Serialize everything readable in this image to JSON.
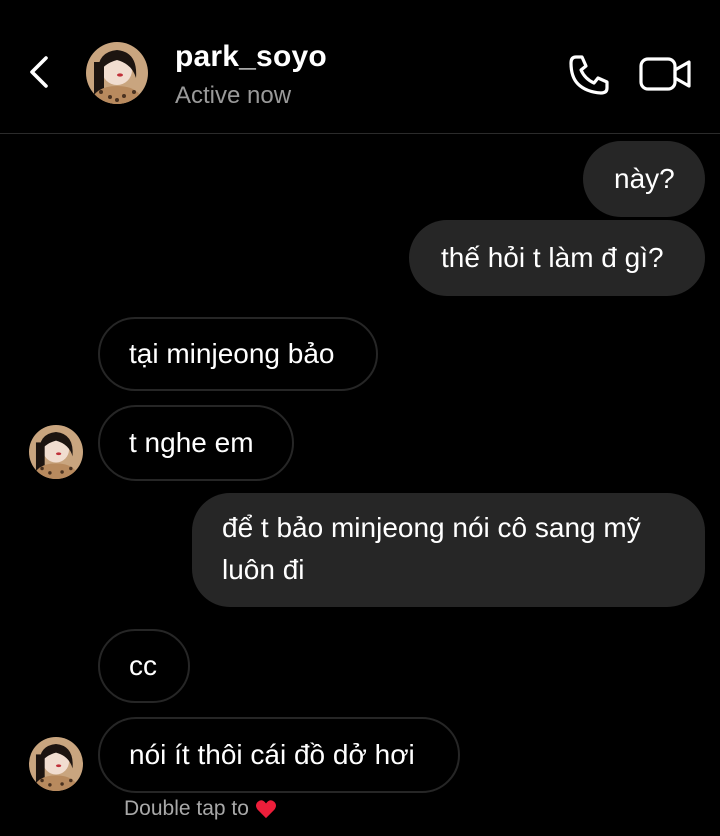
{
  "header": {
    "username": "park_soyo",
    "status": "Active now",
    "icons": {
      "back": "chevron-left-icon",
      "call": "phone-icon",
      "video": "video-camera-icon",
      "avatar": "profile-avatar"
    }
  },
  "messages": [
    {
      "direction": "outgoing",
      "text": "này?"
    },
    {
      "direction": "outgoing",
      "text": "thế hỏi t làm đ gì?"
    },
    {
      "direction": "incoming",
      "text": "tại minjeong bảo"
    },
    {
      "direction": "incoming",
      "text": "t nghe em"
    },
    {
      "direction": "outgoing",
      "text": "để t bảo minjeong nói cô sang mỹ luôn đi"
    },
    {
      "direction": "incoming",
      "text": "cc"
    },
    {
      "direction": "incoming",
      "text": "nói ít thôi cái đồ dở hơi"
    }
  ],
  "hint": {
    "text": "Double tap to",
    "icon": "heart-icon",
    "icon_color": "#ed1e3a"
  },
  "colors": {
    "background": "#000000",
    "outgoing_bubble": "#262626",
    "incoming_border": "#262626",
    "secondary_text": "#9a9a9a"
  }
}
